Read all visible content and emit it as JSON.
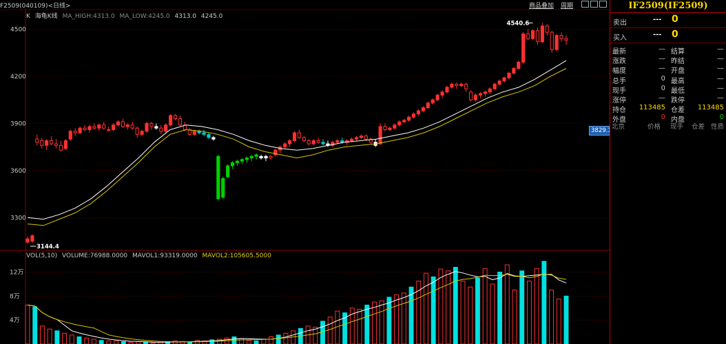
{
  "chart_title": "F2509(040109)<日线>",
  "toolbar": {
    "overlay_label": "商品叠加",
    "period_label": "周期"
  },
  "legend_top": {
    "k_label": "K",
    "indicator": "海龟K线",
    "ma_high": "MA_HIGH:4313.0",
    "ma_low": "MA_LOW:4245.0",
    "v1": "4313.0",
    "v2": "4245.0"
  },
  "legend_vol": {
    "prefix": "VOL(5,10)",
    "volume": "VOLUME:76988.0000",
    "mavol1": "MAVOL1:93319.0000",
    "mavol2": "MAVOL2:105605.5000"
  },
  "price_axis": [
    "4500",
    "4200",
    "3900",
    "3600",
    "3300"
  ],
  "vol_axis": [
    "12万",
    "8万",
    "4万"
  ],
  "annotations": {
    "high": "4540.6",
    "low": "3144.4",
    "current_tag": "3829.1"
  },
  "side": {
    "contract": "IF2509(IF2509)",
    "sell_label": "卖出",
    "sell_dash": "---",
    "sell_qty": "0",
    "buy_label": "买入",
    "buy_dash": "---",
    "buy_qty": "0",
    "rows": [
      {
        "l1": "最新",
        "v1": "—",
        "l2": "结算",
        "v2": "—"
      },
      {
        "l1": "涨跌",
        "v1": "—",
        "l2": "昨结",
        "v2": "—"
      },
      {
        "l1": "幅度",
        "v1": "—",
        "l2": "开盘",
        "v2": "—"
      },
      {
        "l1": "总手",
        "v1": "0",
        "l2": "最高",
        "v2": "—"
      },
      {
        "l1": "现手",
        "v1": "0",
        "l2": "最低",
        "v2": "—"
      },
      {
        "l1": "涨停",
        "v1": "—",
        "l2": "跌停",
        "v2": "—"
      },
      {
        "l1": "持仓",
        "v1": "113485",
        "l2": "仓差",
        "v2": "113485"
      },
      {
        "l1": "外盘",
        "v1": "0",
        "l2": "内盘",
        "v2": "0"
      }
    ],
    "columns": [
      "北京",
      "价格",
      "现手",
      "仓差",
      "性质"
    ]
  },
  "colors": {
    "up": "#ff3030",
    "down": "#00e0e0",
    "green_candle": "#00d000",
    "ma_white": "#ffffff",
    "ma_yellow": "#d8c800",
    "grid": "#8b0000",
    "accent": "#ffd800"
  },
  "chart_data": {
    "type": "candlestick",
    "y_range": [
      3100,
      4620
    ],
    "vol_range": [
      0,
      140000
    ],
    "candles": [
      [
        3165,
        3180,
        3135,
        3144,
        1
      ],
      [
        3150,
        3195,
        3140,
        3185,
        1
      ],
      [
        3800,
        3830,
        3760,
        3780,
        2
      ],
      [
        3790,
        3810,
        3740,
        3760,
        2
      ],
      [
        3760,
        3800,
        3730,
        3790,
        1
      ],
      [
        3790,
        3820,
        3760,
        3770,
        2
      ],
      [
        3770,
        3800,
        3740,
        3760,
        2
      ],
      [
        3760,
        3790,
        3720,
        3730,
        2
      ],
      [
        3740,
        3800,
        3730,
        3790,
        1
      ],
      [
        3800,
        3860,
        3790,
        3850,
        1
      ],
      [
        3850,
        3870,
        3820,
        3840,
        2
      ],
      [
        3840,
        3880,
        3830,
        3870,
        1
      ],
      [
        3870,
        3890,
        3850,
        3860,
        2
      ],
      [
        3860,
        3890,
        3840,
        3880,
        1
      ],
      [
        3880,
        3900,
        3860,
        3870,
        2
      ],
      [
        3870,
        3900,
        3850,
        3890,
        1
      ],
      [
        3890,
        3910,
        3860,
        3870,
        2
      ],
      [
        3860,
        3880,
        3850,
        3860,
        2
      ],
      [
        3860,
        3900,
        3850,
        3890,
        1
      ],
      [
        3890,
        3920,
        3880,
        3910,
        1
      ],
      [
        3910,
        3930,
        3870,
        3880,
        2
      ],
      [
        3880,
        3900,
        3860,
        3890,
        1
      ],
      [
        3890,
        3910,
        3860,
        3870,
        2
      ],
      [
        3870,
        3880,
        3810,
        3830,
        2
      ],
      [
        3830,
        3860,
        3820,
        3850,
        1
      ],
      [
        3850,
        3910,
        3840,
        3900,
        1
      ],
      [
        3900,
        3910,
        3860,
        3880,
        2
      ],
      [
        3880,
        3900,
        3860,
        3870,
        5
      ],
      [
        3870,
        3890,
        3830,
        3850,
        2
      ],
      [
        3850,
        3900,
        3840,
        3890,
        1
      ],
      [
        3890,
        3960,
        3880,
        3950,
        1
      ],
      [
        3950,
        3960,
        3920,
        3930,
        2
      ],
      [
        3930,
        3950,
        3880,
        3890,
        2
      ],
      [
        3890,
        3910,
        3850,
        3860,
        2
      ],
      [
        3860,
        3870,
        3820,
        3830,
        2
      ],
      [
        3830,
        3860,
        3820,
        3850,
        1
      ],
      [
        3850,
        3860,
        3830,
        3840,
        4
      ],
      [
        3840,
        3860,
        3820,
        3830,
        4
      ],
      [
        3830,
        3840,
        3800,
        3810,
        4
      ],
      [
        3810,
        3820,
        3790,
        3800,
        5
      ],
      [
        3690,
        3700,
        3410,
        3420,
        3
      ],
      [
        3430,
        3560,
        3420,
        3550,
        3
      ],
      [
        3560,
        3640,
        3550,
        3630,
        3
      ],
      [
        3630,
        3660,
        3610,
        3650,
        3
      ],
      [
        3650,
        3670,
        3630,
        3660,
        3
      ],
      [
        3660,
        3680,
        3640,
        3670,
        3
      ],
      [
        3670,
        3690,
        3650,
        3680,
        3
      ],
      [
        3680,
        3700,
        3660,
        3690,
        3
      ],
      [
        3690,
        3710,
        3670,
        3700,
        3
      ],
      [
        3690,
        3700,
        3670,
        3680,
        5
      ],
      [
        3680,
        3700,
        3660,
        3690,
        5
      ],
      [
        3690,
        3700,
        3670,
        3680,
        2
      ],
      [
        3700,
        3740,
        3690,
        3730,
        1
      ],
      [
        3730,
        3760,
        3710,
        3750,
        1
      ],
      [
        3750,
        3780,
        3740,
        3770,
        1
      ],
      [
        3770,
        3800,
        3750,
        3790,
        1
      ],
      [
        3790,
        3850,
        3780,
        3840,
        1
      ],
      [
        3840,
        3860,
        3800,
        3810,
        2
      ],
      [
        3810,
        3820,
        3780,
        3790,
        2
      ],
      [
        3790,
        3800,
        3760,
        3770,
        2
      ],
      [
        3770,
        3800,
        3760,
        3790,
        1
      ],
      [
        3790,
        3810,
        3770,
        3780,
        2
      ],
      [
        3780,
        3800,
        3760,
        3770,
        4
      ],
      [
        3770,
        3790,
        3750,
        3760,
        5
      ],
      [
        3760,
        3790,
        3750,
        3780,
        1
      ],
      [
        3780,
        3800,
        3770,
        3790,
        1
      ],
      [
        3790,
        3810,
        3770,
        3780,
        4
      ],
      [
        3780,
        3800,
        3760,
        3790,
        1
      ],
      [
        3790,
        3810,
        3780,
        3800,
        1
      ],
      [
        3800,
        3820,
        3790,
        3810,
        1
      ],
      [
        3810,
        3830,
        3800,
        3820,
        1
      ],
      [
        3820,
        3830,
        3790,
        3800,
        2
      ],
      [
        3800,
        3810,
        3770,
        3780,
        2
      ],
      [
        3780,
        3800,
        3750,
        3760,
        5
      ],
      [
        3770,
        3900,
        3760,
        3880,
        1
      ],
      [
        3880,
        3900,
        3850,
        3860,
        2
      ],
      [
        3860,
        3880,
        3850,
        3870,
        1
      ],
      [
        3870,
        3900,
        3860,
        3890,
        1
      ],
      [
        3890,
        3920,
        3880,
        3910,
        1
      ],
      [
        3910,
        3930,
        3900,
        3920,
        1
      ],
      [
        3920,
        3950,
        3910,
        3940,
        1
      ],
      [
        3940,
        3970,
        3930,
        3960,
        1
      ],
      [
        3960,
        3990,
        3950,
        3980,
        1
      ],
      [
        3980,
        4010,
        3970,
        4000,
        1
      ],
      [
        4000,
        4040,
        3990,
        4030,
        1
      ],
      [
        4030,
        4060,
        4020,
        4050,
        1
      ],
      [
        4050,
        4090,
        4040,
        4080,
        1
      ],
      [
        4080,
        4110,
        4060,
        4100,
        1
      ],
      [
        4100,
        4140,
        4090,
        4130,
        1
      ],
      [
        4130,
        4160,
        4120,
        4150,
        1
      ],
      [
        4150,
        4160,
        4120,
        4140,
        2
      ],
      [
        4140,
        4160,
        4130,
        4150,
        1
      ],
      [
        4150,
        4160,
        4100,
        4120,
        2
      ],
      [
        4100,
        4110,
        4040,
        4050,
        2
      ],
      [
        4050,
        4090,
        4040,
        4080,
        1
      ],
      [
        4080,
        4100,
        4060,
        4090,
        1
      ],
      [
        4090,
        4110,
        4070,
        4100,
        1
      ],
      [
        4100,
        4130,
        4090,
        4120,
        1
      ],
      [
        4120,
        4160,
        4110,
        4150,
        1
      ],
      [
        4150,
        4180,
        4140,
        4170,
        1
      ],
      [
        4170,
        4200,
        4160,
        4190,
        1
      ],
      [
        4190,
        4230,
        4180,
        4220,
        1
      ],
      [
        4220,
        4260,
        4210,
        4250,
        1
      ],
      [
        4250,
        4300,
        4240,
        4290,
        1
      ],
      [
        4290,
        4480,
        4280,
        4470,
        1
      ],
      [
        4470,
        4500,
        4430,
        4440,
        2
      ],
      [
        4440,
        4500,
        4430,
        4490,
        1
      ],
      [
        4490,
        4510,
        4400,
        4420,
        2
      ],
      [
        4420,
        4540,
        4410,
        4520,
        1
      ],
      [
        4520,
        4530,
        4460,
        4480,
        2
      ],
      [
        4480,
        4490,
        4350,
        4370,
        2
      ],
      [
        4370,
        4470,
        4360,
        4460,
        1
      ],
      [
        4460,
        4480,
        4420,
        4440,
        2
      ],
      [
        4440,
        4460,
        4400,
        4430,
        2
      ]
    ],
    "ma_white": [
      3300,
      3290,
      3320,
      3360,
      3420,
      3500,
      3590,
      3680,
      3780,
      3860,
      3890,
      3880,
      3860,
      3830,
      3790,
      3760,
      3740,
      3730,
      3740,
      3760,
      3780,
      3790,
      3800,
      3820,
      3840,
      3870,
      3910,
      3960,
      4010,
      4060,
      4100,
      4130,
      4180,
      4240,
      4300
    ],
    "ma_yellow": [
      3260,
      3250,
      3290,
      3330,
      3390,
      3470,
      3560,
      3650,
      3750,
      3830,
      3860,
      3850,
      3830,
      3800,
      3750,
      3720,
      3700,
      3680,
      3700,
      3730,
      3750,
      3760,
      3770,
      3790,
      3810,
      3840,
      3880,
      3930,
      3980,
      4030,
      4070,
      4100,
      4140,
      4200,
      4250
    ],
    "volume": [
      65000,
      62000,
      30000,
      25000,
      22000,
      18000,
      15000,
      12000,
      10000,
      8000,
      6000,
      5000,
      5000,
      4000,
      3000,
      4000,
      3000,
      2000,
      3000,
      4000,
      5000,
      4000,
      3000,
      6000,
      5000,
      7000,
      8000,
      10000,
      12000,
      9000,
      6000,
      5000,
      8000,
      12000,
      15000,
      18000,
      22000,
      26000,
      30000,
      28000,
      38000,
      45000,
      55000,
      52000,
      60000,
      58000,
      65000,
      70000,
      72000,
      78000,
      82000,
      85000,
      95000,
      105000,
      118000,
      112000,
      125000,
      122000,
      128000,
      105000,
      95000,
      110000,
      126000,
      100000,
      120000,
      132000,
      90000,
      122000,
      105000,
      126000,
      138000,
      90000,
      75000,
      80000
    ]
  }
}
